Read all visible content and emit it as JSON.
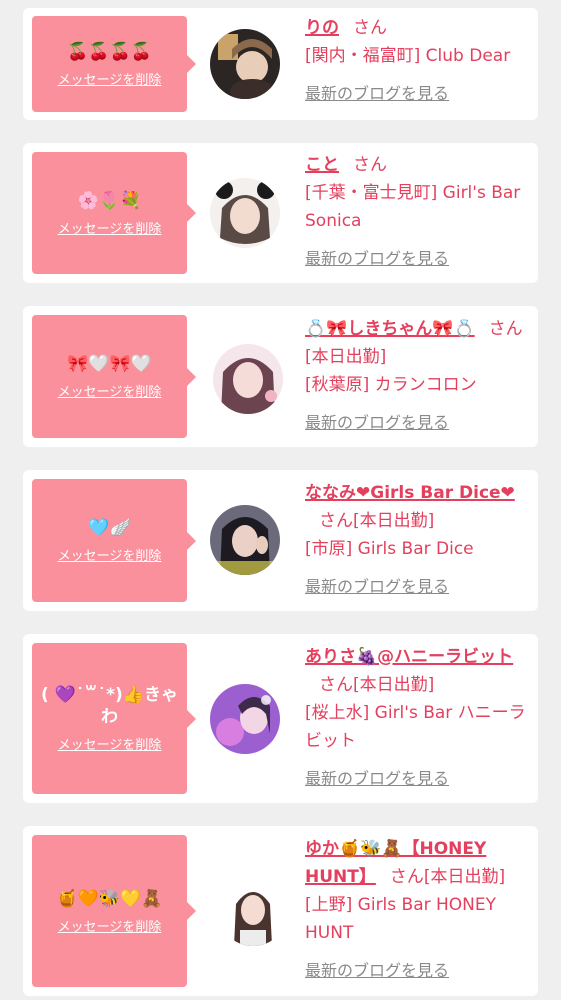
{
  "cards": [
    {
      "message": "🍒🍒🍒🍒",
      "delete_label": "メッセージを削除",
      "name": "りの",
      "san": "さん",
      "status": "",
      "shop": "[関内・福富町] Club Dear",
      "blog_link": "最新のブログを見る"
    },
    {
      "message": "🌸🌷💐",
      "delete_label": "メッセージを削除",
      "name": "こと",
      "san": "さん",
      "status": "",
      "shop": "[千葉・富士見町] Girl's Bar Sonica",
      "blog_link": "最新のブログを見る"
    },
    {
      "message": "🎀🤍🎀🤍",
      "delete_label": "メッセージを削除",
      "name": "💍🎀しきちゃん🎀💍",
      "san": "さん",
      "status": "[本日出勤]",
      "shop": "[秋葉原] カランコロン",
      "blog_link": "最新のブログを見る"
    },
    {
      "message": "🩵🪽",
      "delete_label": "メッセージを削除",
      "name": "ななみ❤Girls Bar Dice❤",
      "san": "さん",
      "status": "[本日出勤]",
      "shop": "[市原] Girls Bar Dice",
      "blog_link": "最新のブログを見る"
    },
    {
      "message": "( 💜˙꒳˙*)👍きゃわ",
      "delete_label": "メッセージを削除",
      "name": "ありさ🍇@ハニーラビット",
      "san": "さん",
      "status": "[本日出勤]",
      "shop": "[桜上水] Girl's Bar ハニーラビット",
      "blog_link": "最新のブログを見る"
    },
    {
      "message": "🍯🧡🐝💛🧸",
      "delete_label": "メッセージを削除",
      "name": "ゆか🍯🐝🧸【HONEY HUNT】",
      "san": "さん",
      "status": "[本日出勤]",
      "shop": "[上野] Girls Bar HONEY HUNT",
      "blog_link": "最新のブログを見る"
    }
  ]
}
